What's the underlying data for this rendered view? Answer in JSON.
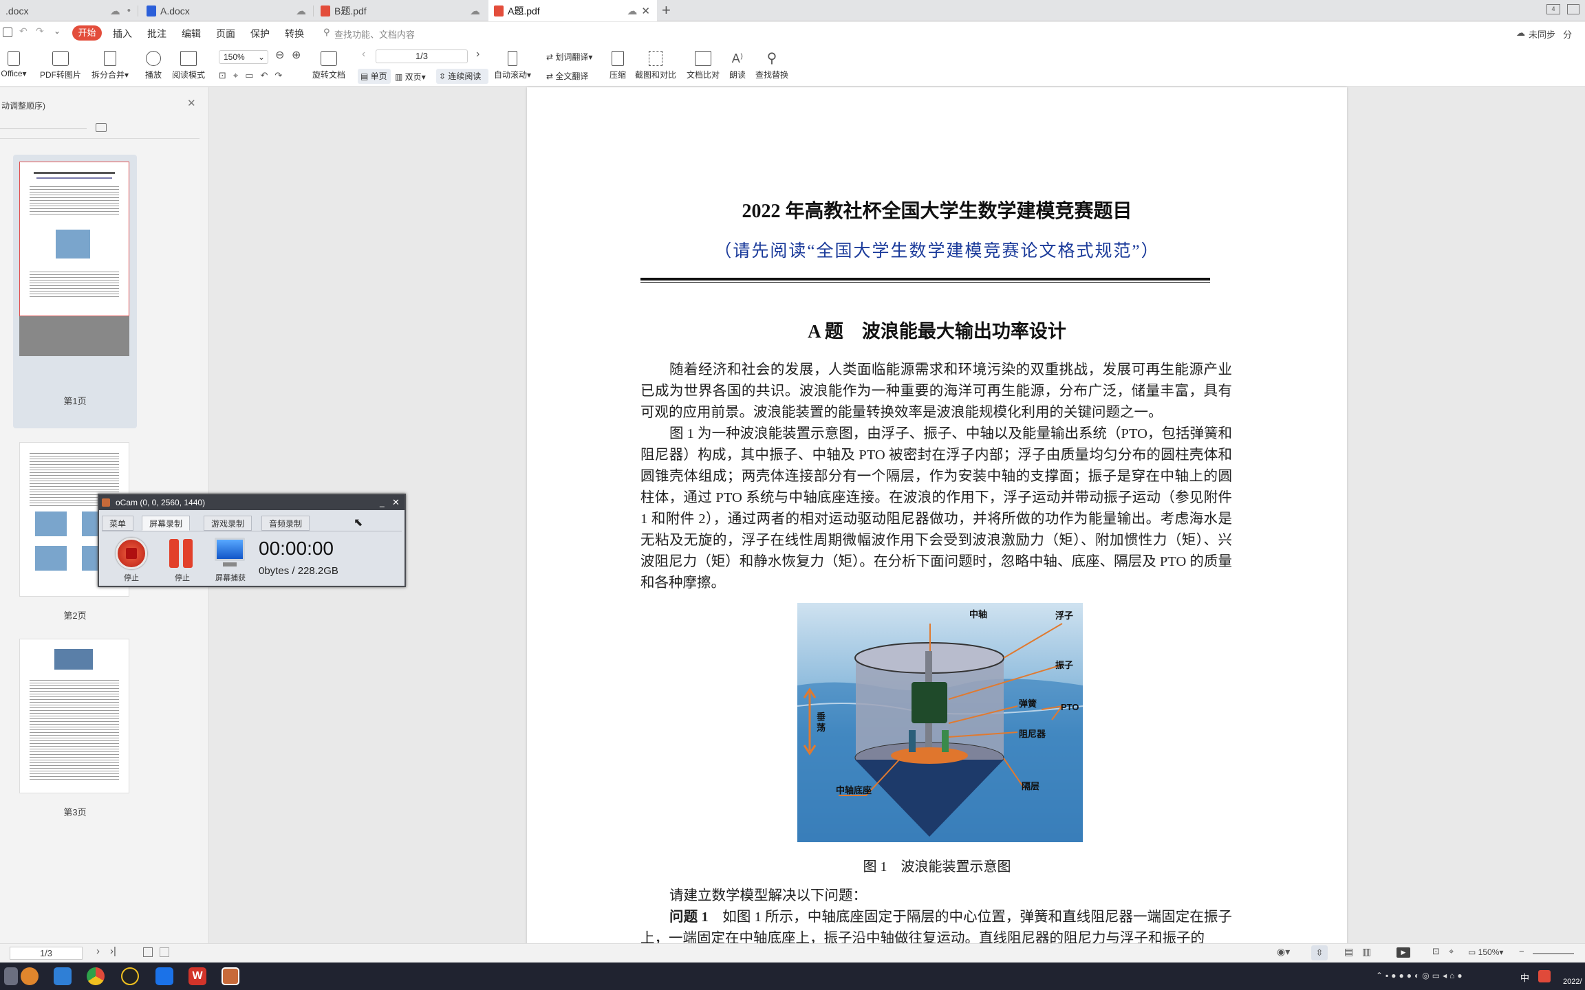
{
  "tabs": [
    {
      "label": ".docx",
      "color": "#9aa0a6",
      "active": false
    },
    {
      "label": "A.docx",
      "color": "#2b5fd9",
      "active": false
    },
    {
      "label": "B题.pdf",
      "color": "#e34d3b",
      "active": false
    },
    {
      "label": "A题.pdf",
      "color": "#e34d3b",
      "active": true
    }
  ],
  "menu": {
    "start": "开始",
    "items": [
      "插入",
      "批注",
      "编辑",
      "页面",
      "保护",
      "转换"
    ],
    "search_placeholder": "查找功能、文档内容",
    "sync": "未同步",
    "share": "分"
  },
  "toolbar": {
    "office": "Office",
    "pdf_to_image": "PDF转图片",
    "split_merge": "拆分合并",
    "play": "播放",
    "read_mode": "阅读模式",
    "zoom": "150%",
    "rotate_doc": "旋转文档",
    "page_input": "1/3",
    "single_page": "单页",
    "double_page": "双页",
    "continuous": "连续阅读",
    "auto_scroll": "自动滚动",
    "translate_select": "划词翻译",
    "translate_full": "全文翻译",
    "compress": "压缩",
    "screenshot_compare": "截图和对比",
    "doc_compare": "文档比对",
    "read_aloud": "朗读",
    "find_replace": "查找替换"
  },
  "sidepanel": {
    "header": "动调整顺序)",
    "pages": [
      "第1页",
      "第2页",
      "第3页"
    ]
  },
  "document": {
    "title": "2022 年高教社杯全国大学生数学建模竞赛题目",
    "subtitle": "（请先阅读“全国大学生数学建模竞赛论文格式规范”）",
    "problem_title": "A 题　波浪能最大输出功率设计",
    "para1": "随着经济和社会的发展，人类面临能源需求和环境污染的双重挑战，发展可再生能源产业已成为世界各国的共识。波浪能作为一种重要的海洋可再生能源，分布广泛，储量丰富，具有可观的应用前景。波浪能装置的能量转换效率是波浪能规模化利用的关键问题之一。",
    "para2": "图 1 为一种波浪能装置示意图，由浮子、振子、中轴以及能量输出系统（PTO，包括弹簧和阻尼器）构成，其中振子、中轴及 PTO 被密封在浮子内部；浮子由质量均匀分布的圆柱壳体和圆锥壳体组成；两壳体连接部分有一个隔层，作为安装中轴的支撑面；振子是穿在中轴上的圆柱体，通过 PTO 系统与中轴底座连接。在波浪的作用下，浮子运动并带动振子运动（参见附件 1 和附件 2），通过两者的相对运动驱动阻尼器做功，并将所做的功作为能量输出。考虑海水是无粘及无旋的，浮子在线性周期微幅波作用下会受到波浪激励力（矩）、附加惯性力（矩）、兴波阻尼力（矩）和静水恢复力（矩）。在分析下面问题时，忽略中轴、底座、隔层及 PTO 的质量和各种摩擦。",
    "figure_labels": {
      "axis": "中轴",
      "float": "浮子",
      "oscillator": "振子",
      "spring": "弹簧",
      "pto": "PTO",
      "damper": "阻尼器",
      "heave": "垂荡",
      "base": "中轴底座",
      "partition": "隔层"
    },
    "figure_caption": "图 1　波浪能装置示意图",
    "para3": "请建立数学模型解决以下问题：",
    "q1_label": "问题 1",
    "q1_text": "如图 1 所示，中轴底座固定于隔层的中心位置，弹簧和直线阻尼器一端固定在振子上，一端固定在中轴底座上，振子沿中轴做往复运动。直线阻尼器的阻尼力与浮子和振子的"
  },
  "ocam": {
    "title": "oCam (0, 0, 2560, 1440)",
    "tabs": [
      "菜单",
      "屏幕录制",
      "游戏录制",
      "音频录制"
    ],
    "stop": "停止",
    "pause": "停止",
    "capture": "屏幕捕获",
    "time": "00:00:00",
    "size": "0bytes / 228.2GB"
  },
  "status": {
    "page": "1/3",
    "zoom": "150%"
  },
  "taskbar": {
    "ime": "中",
    "date": "2022/"
  }
}
